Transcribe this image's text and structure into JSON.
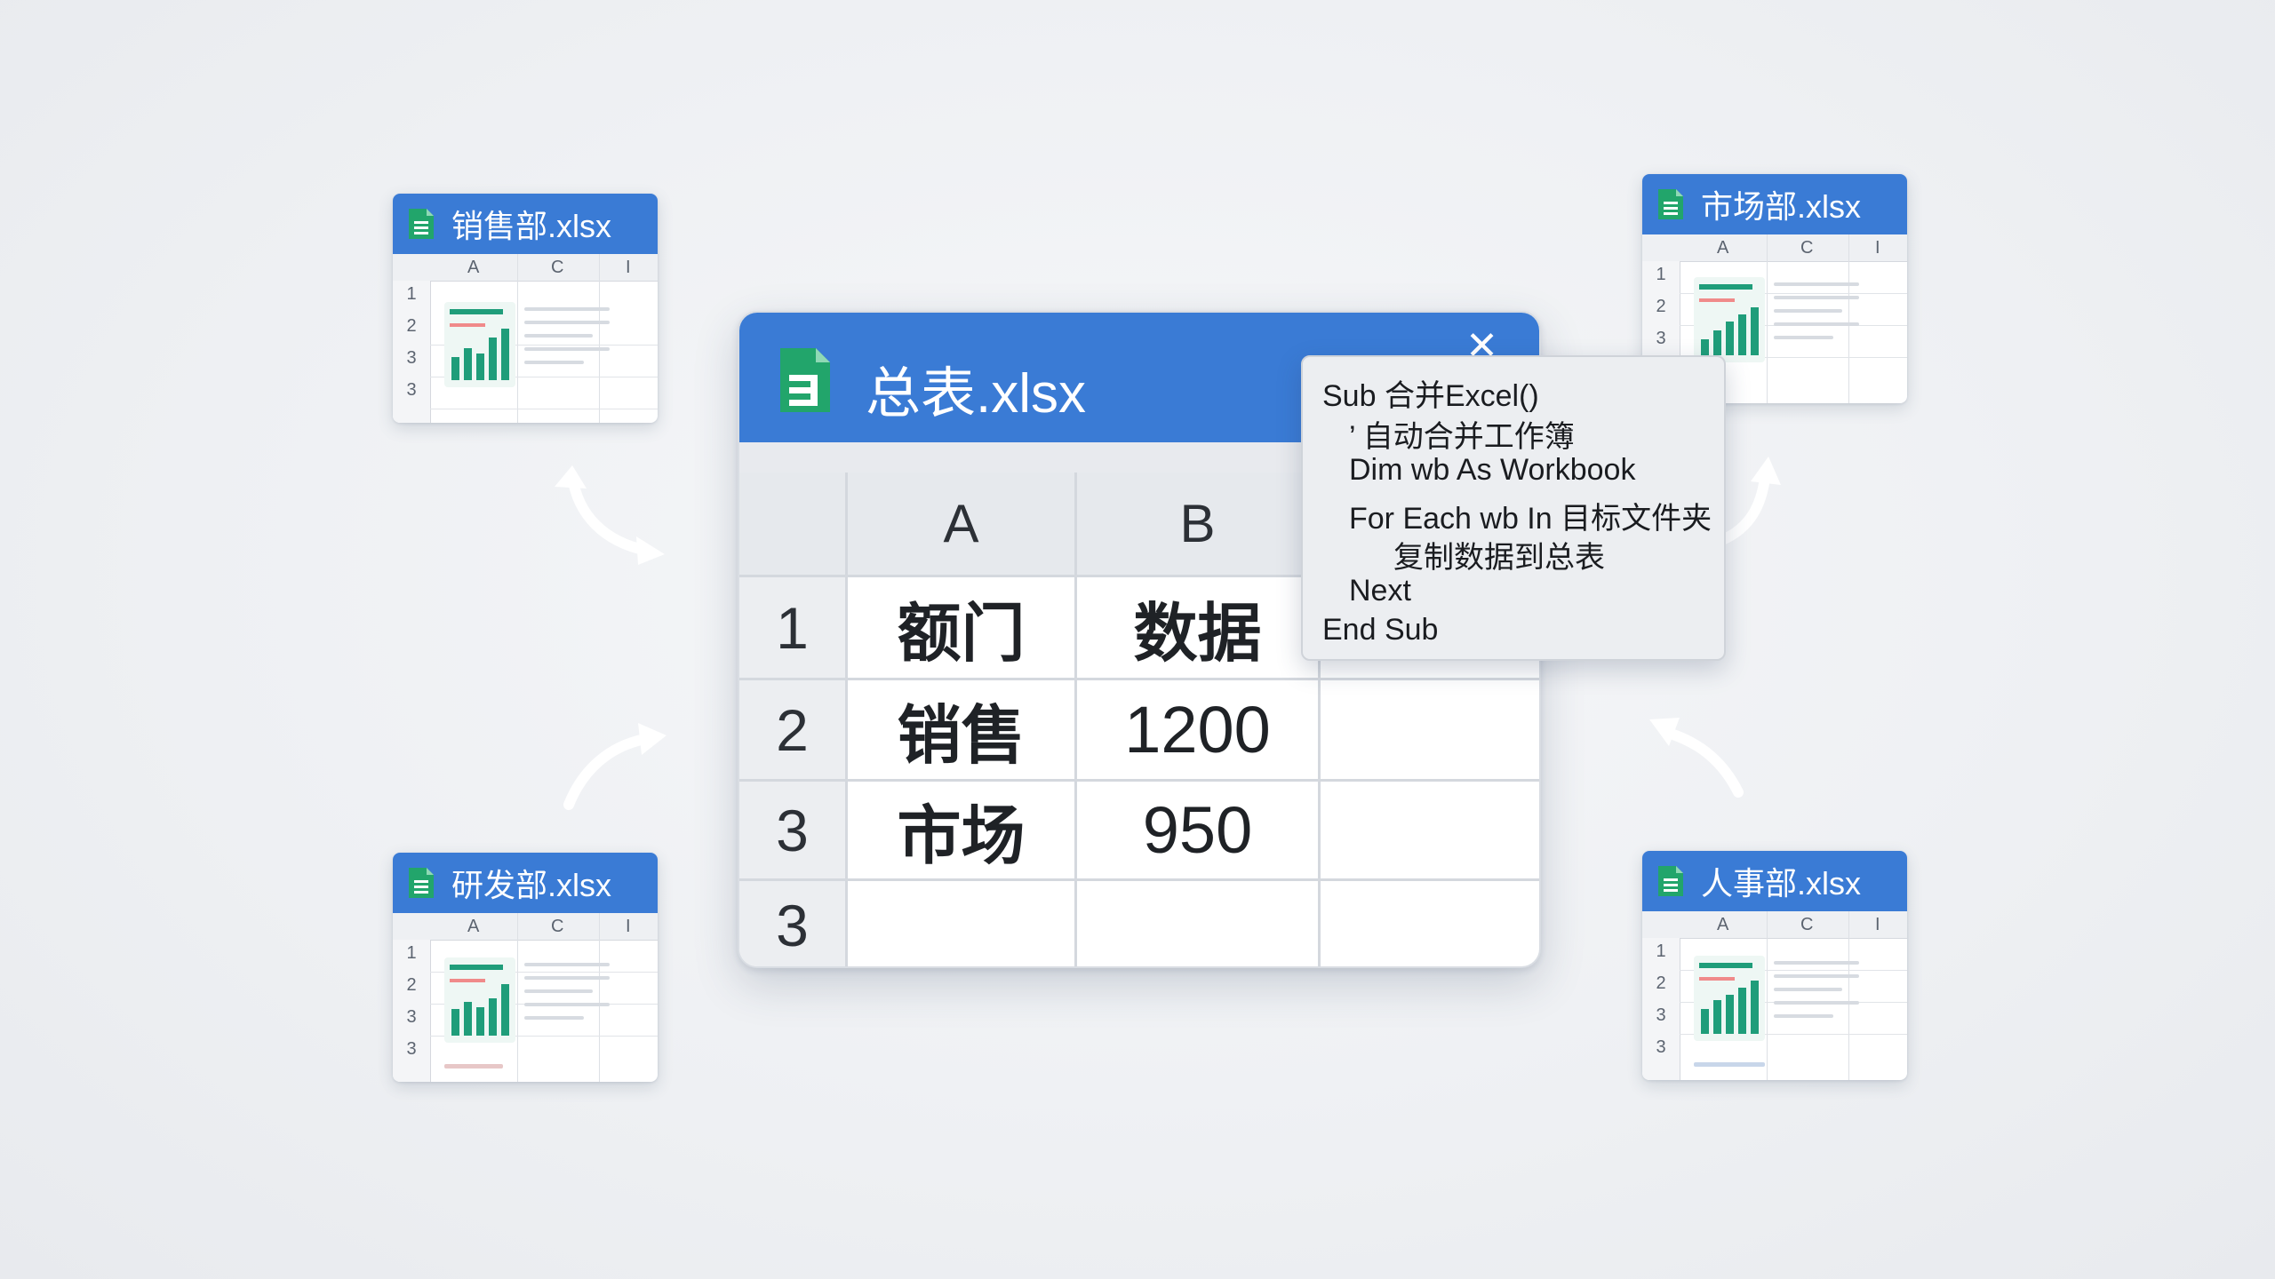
{
  "main_workbook": {
    "title": "总表.xlsx",
    "close_glyph": "✕",
    "columns": [
      "A",
      "B"
    ],
    "rows": [
      {
        "row": "1",
        "a": "额门",
        "b": "数据"
      },
      {
        "row": "2",
        "a": "销售",
        "b": "1200"
      },
      {
        "row": "3",
        "a": "市场",
        "b": "950"
      },
      {
        "row": "3",
        "a": "",
        "b": ""
      }
    ]
  },
  "vba_code": [
    "Sub 合并Excel()",
    "’ 自动合并工作簿",
    "Dim wb As Workbook",
    "For Each wb In 目标文件夹",
    "复制数据到总表",
    "Next",
    "End Sub"
  ],
  "source_workbooks": [
    {
      "title": "销售部.xlsx",
      "col_headers": [
        "A",
        "C",
        "I"
      ],
      "row_numbers": [
        "1",
        "2",
        "3",
        "3"
      ]
    },
    {
      "title": "市场部.xlsx",
      "col_headers": [
        "A",
        "C",
        "I"
      ],
      "row_numbers": [
        "1",
        "2",
        "3"
      ]
    },
    {
      "title": "研发部.xlsx",
      "col_headers": [
        "A",
        "C",
        "I"
      ],
      "row_numbers": [
        "1",
        "2",
        "3",
        "3"
      ]
    },
    {
      "title": "人事部.xlsx",
      "col_headers": [
        "A",
        "C",
        "I"
      ],
      "row_numbers": [
        "1",
        "2",
        "3",
        "3"
      ]
    }
  ],
  "icons": {
    "file": "sheets-file-icon",
    "arrow": "merge-arrow-icon"
  },
  "colors": {
    "title_bar": "#3a7bd5",
    "file_icon": "#22a56b",
    "chart_bars": "#1f9d7a",
    "arrow": "#ffffff"
  }
}
